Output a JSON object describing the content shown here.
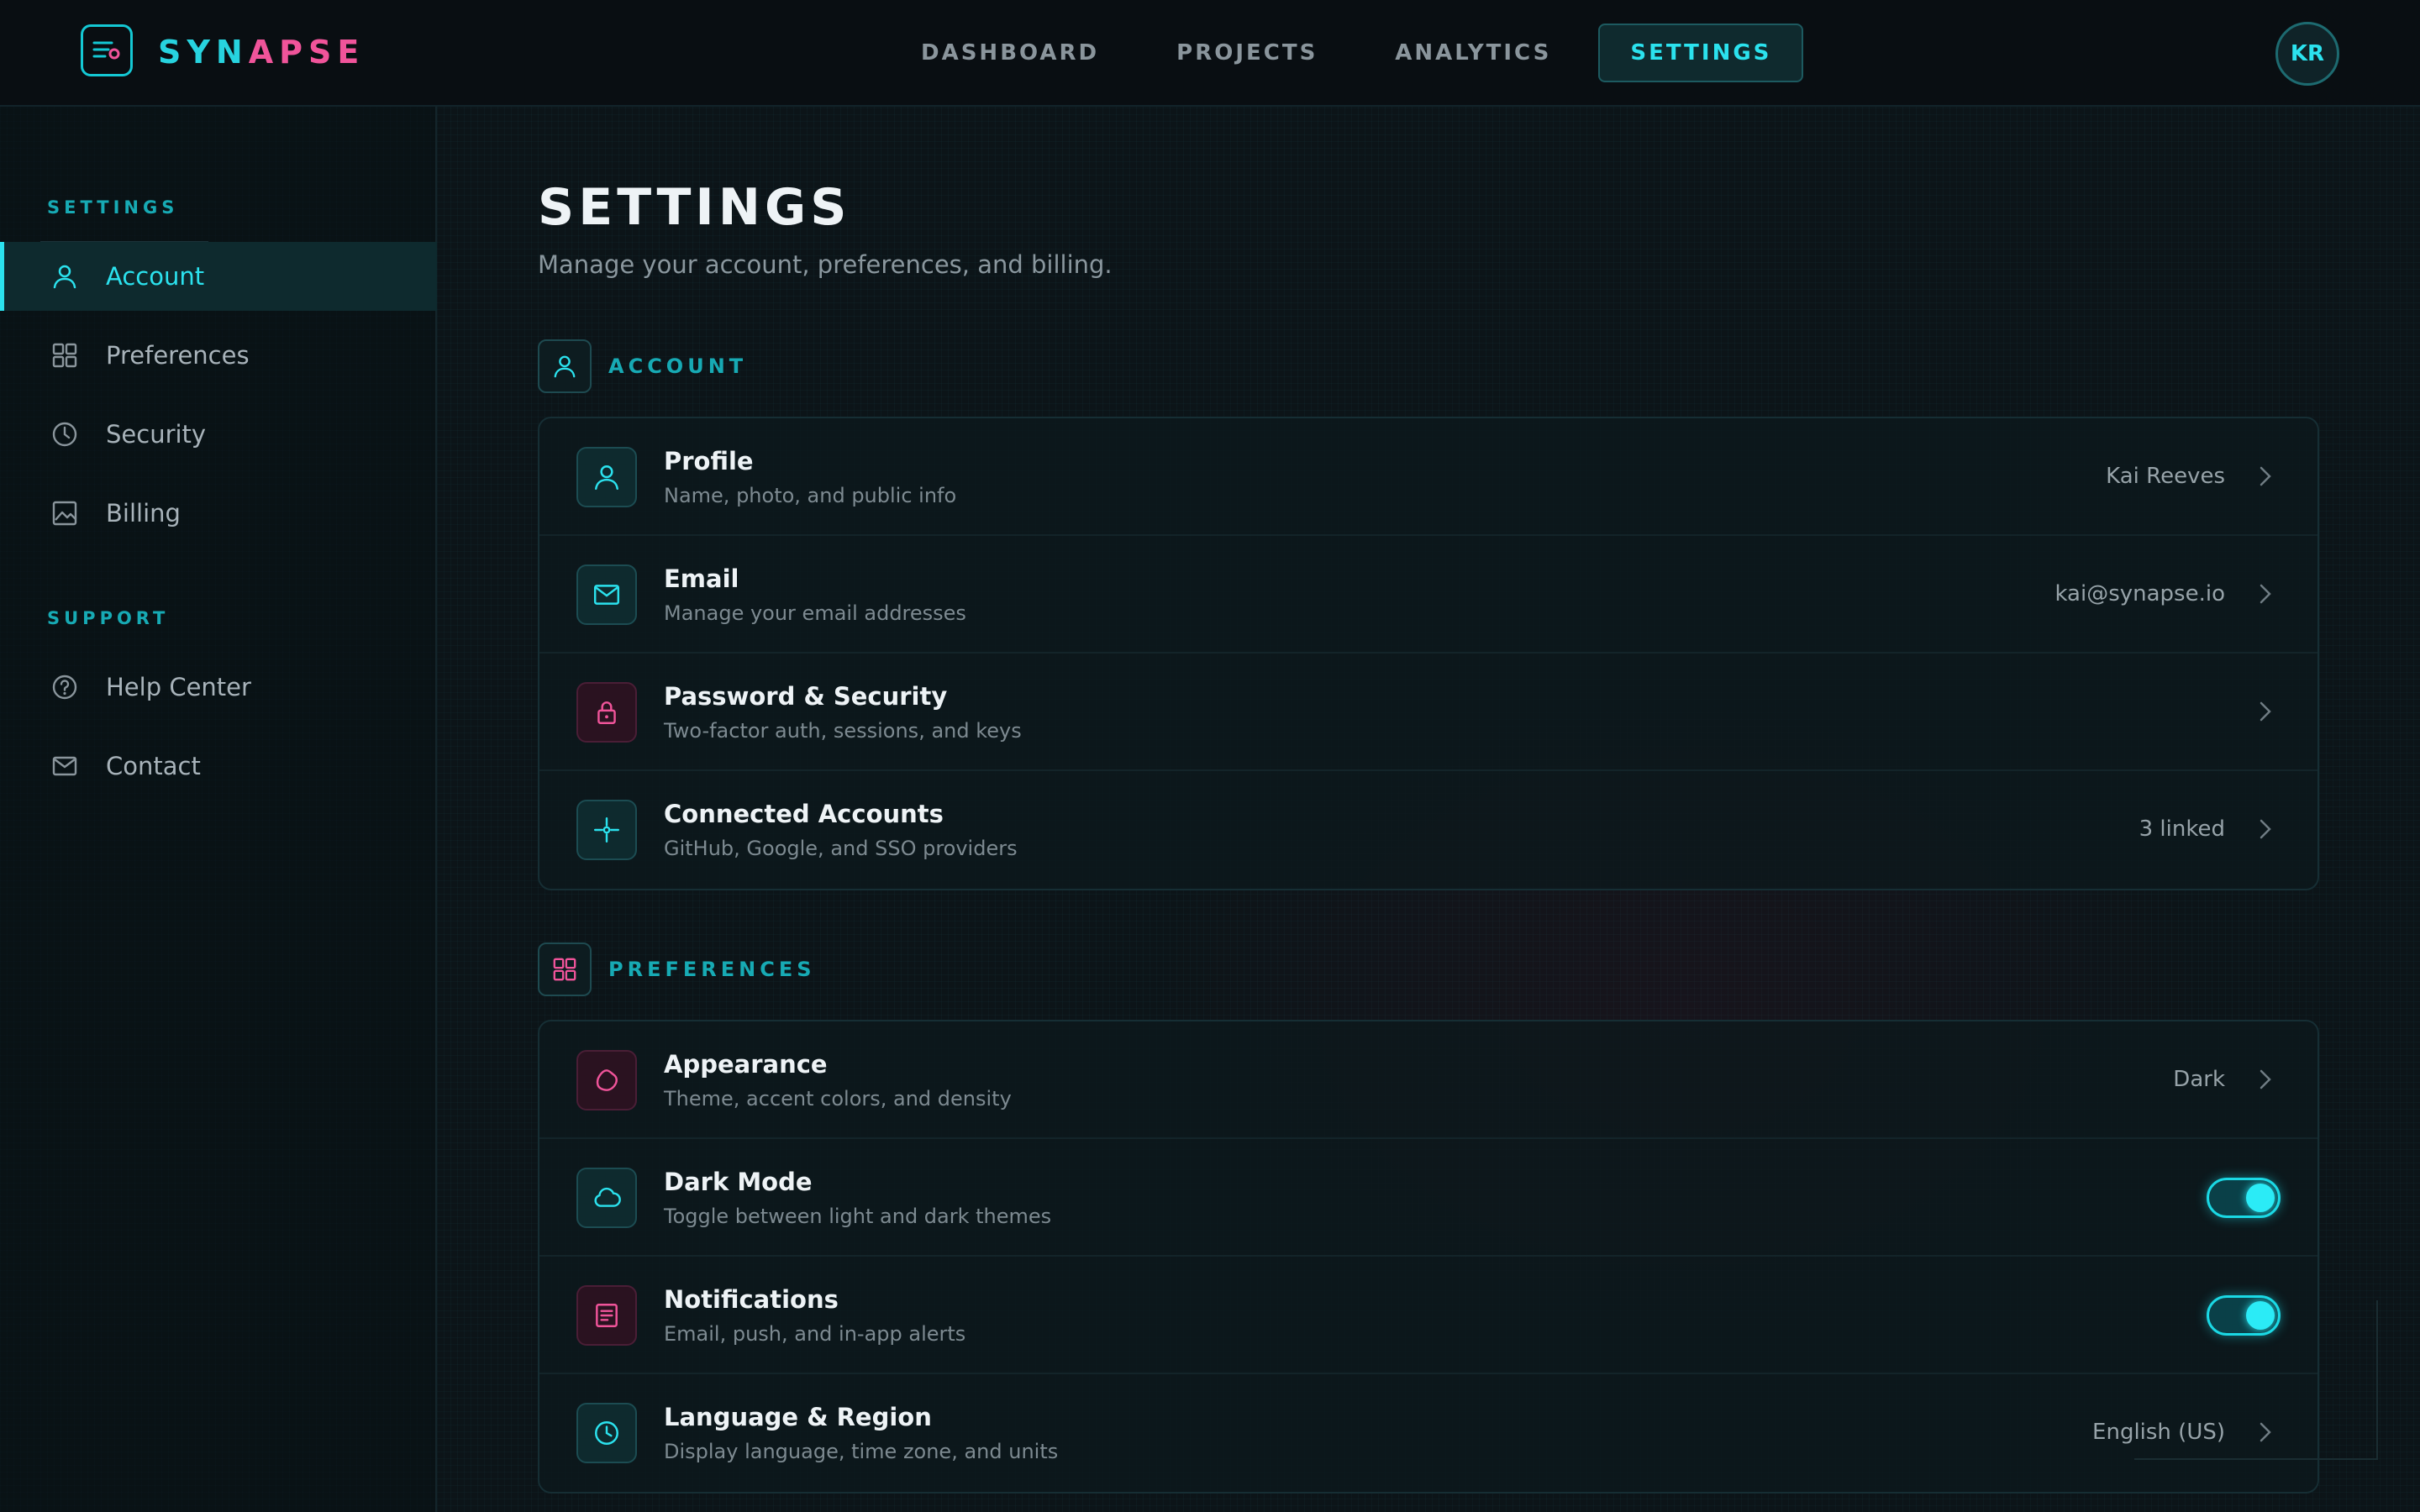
{
  "header": {
    "brand_part1": "SYN",
    "brand_part2": "APSE",
    "nav": [
      "DASHBOARD",
      "PROJECTS",
      "ANALYTICS",
      "SETTINGS"
    ],
    "active_nav": "SETTINGS",
    "avatar_initials": "KR"
  },
  "sidebar": {
    "settings_heading": "SETTINGS",
    "settings_items": [
      {
        "label": "Account",
        "icon": "user-icon",
        "active": true
      },
      {
        "label": "Preferences",
        "icon": "grid-icon",
        "active": false
      },
      {
        "label": "Security",
        "icon": "clock-icon",
        "active": false
      },
      {
        "label": "Billing",
        "icon": "image-icon",
        "active": false
      }
    ],
    "support_heading": "SUPPORT",
    "support_items": [
      {
        "label": "Help Center",
        "icon": "help-icon"
      },
      {
        "label": "Contact",
        "icon": "mail-icon"
      }
    ]
  },
  "main": {
    "title": "SETTINGS",
    "subtitle": "Manage your account, preferences, and billing.",
    "account_section": {
      "label": "ACCOUNT",
      "rows": [
        {
          "title": "Profile",
          "desc": "Name, photo, and public info",
          "value": "Kai Reeves",
          "icon": "user-icon"
        },
        {
          "title": "Email",
          "desc": "Manage your email addresses",
          "value": "kai@synapse.io",
          "icon": "mail-icon"
        },
        {
          "title": "Password & Security",
          "desc": "Two-factor auth, sessions, and keys",
          "value": "",
          "icon": "lock-icon"
        },
        {
          "title": "Connected Accounts",
          "desc": "GitHub, Google, and SSO providers",
          "value": "3 linked",
          "icon": "crosshair-icon"
        }
      ]
    },
    "preferences_section": {
      "label": "PREFERENCES",
      "rows": [
        {
          "title": "Appearance",
          "desc": "Theme, accent colors, and density",
          "value": "Dark",
          "icon": "blob-icon"
        },
        {
          "title": "Dark Mode",
          "desc": "Toggle between light and dark themes",
          "toggle": true,
          "icon": "cloud-icon"
        },
        {
          "title": "Notifications",
          "desc": "Email, push, and in-app alerts",
          "toggle": true,
          "icon": "note-icon"
        },
        {
          "title": "Language & Region",
          "desc": "Display language, time zone, and units",
          "value": "English (US)",
          "icon": "clock-icon"
        }
      ]
    }
  },
  "colors": {
    "accent": "#2be2ee",
    "pink": "#f0549a",
    "bg": "#0c1418"
  }
}
